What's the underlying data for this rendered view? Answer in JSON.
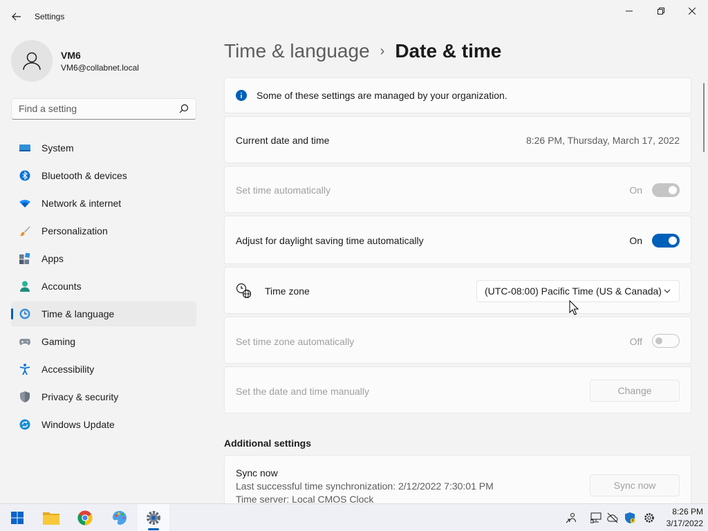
{
  "window": {
    "title": "Settings"
  },
  "user": {
    "name": "VM6",
    "email": "VM6@collabnet.local"
  },
  "search": {
    "placeholder": "Find a setting"
  },
  "nav": [
    {
      "label": "System",
      "icon": "system-icon"
    },
    {
      "label": "Bluetooth & devices",
      "icon": "bluetooth-icon"
    },
    {
      "label": "Network & internet",
      "icon": "wifi-icon"
    },
    {
      "label": "Personalization",
      "icon": "brush-icon"
    },
    {
      "label": "Apps",
      "icon": "apps-icon"
    },
    {
      "label": "Accounts",
      "icon": "accounts-icon"
    },
    {
      "label": "Time & language",
      "icon": "time-language-icon",
      "selected": true
    },
    {
      "label": "Gaming",
      "icon": "gaming-icon"
    },
    {
      "label": "Accessibility",
      "icon": "accessibility-icon"
    },
    {
      "label": "Privacy & security",
      "icon": "shield-icon"
    },
    {
      "label": "Windows Update",
      "icon": "update-icon"
    }
  ],
  "header": {
    "parent": "Time & language",
    "separator": "›",
    "current": "Date & time"
  },
  "info": {
    "text": "Some of these settings are managed by your organization."
  },
  "current_datetime": {
    "label": "Current date and time",
    "value": "8:26 PM, Thursday, March 17, 2022"
  },
  "set_time_auto": {
    "label": "Set time automatically",
    "state": "On",
    "enabled": false,
    "on": true
  },
  "daylight": {
    "label": "Adjust for daylight saving time automatically",
    "state": "On",
    "enabled": true,
    "on": true
  },
  "timezone": {
    "label": "Time zone",
    "value": "(UTC-08:00) Pacific Time (US & Canada)"
  },
  "timezone_auto": {
    "label": "Set time zone automatically",
    "state": "Off",
    "enabled": false,
    "on": false
  },
  "manual": {
    "label": "Set the date and time manually",
    "button": "Change"
  },
  "additional": {
    "title": "Additional settings",
    "sync_title": "Sync now",
    "sync_last": "Last successful time synchronization: 2/12/2022 7:30:01 PM",
    "sync_server": "Time server: Local CMOS Clock",
    "sync_button": "Sync now"
  },
  "taskbar": {
    "apps": [
      "start-icon",
      "file-explorer-icon",
      "chrome-icon",
      "paint-icon",
      "settings-icon"
    ],
    "tray": [
      "people-icon",
      "network-wired-icon",
      "cloud-off-icon",
      "security-shield-icon",
      "gear-icon"
    ],
    "clock_time": "8:26 PM",
    "clock_date": "3/17/2022"
  },
  "colors": {
    "accent": "#005fb8",
    "background": "#f3f3f3",
    "card": "#fbfbfb"
  }
}
